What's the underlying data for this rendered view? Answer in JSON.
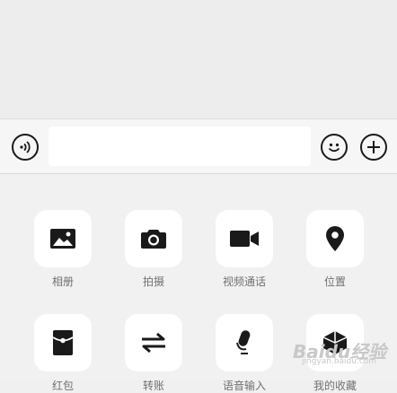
{
  "input_bar": {
    "voice_icon": "voice-icon",
    "text_value": "",
    "emoji_icon": "emoji-icon",
    "plus_icon": "plus-icon"
  },
  "panel": {
    "items": [
      {
        "label": "相册",
        "icon": "image-icon"
      },
      {
        "label": "拍摄",
        "icon": "camera-icon"
      },
      {
        "label": "视频通话",
        "icon": "video-icon"
      },
      {
        "label": "位置",
        "icon": "location-icon"
      },
      {
        "label": "红包",
        "icon": "red-packet-icon"
      },
      {
        "label": "转账",
        "icon": "transfer-icon"
      },
      {
        "label": "语音输入",
        "icon": "mic-icon"
      },
      {
        "label": "我的收藏",
        "icon": "favorites-icon"
      }
    ]
  },
  "watermark": {
    "main": "Baidu经验",
    "sub": "jingyan.baidu.com"
  }
}
